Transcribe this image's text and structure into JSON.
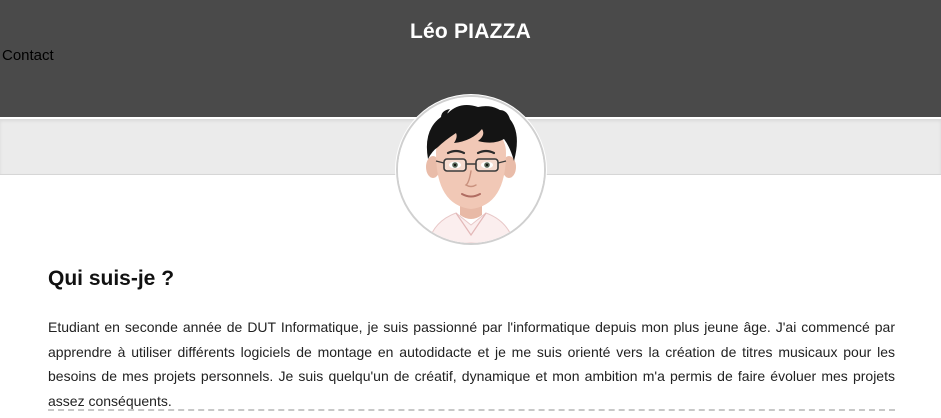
{
  "header": {
    "title": "Léo PIAZZA",
    "nav": {
      "contact_label": "Contact"
    },
    "background_color": "#4a4a4a"
  },
  "avatar": {
    "icon": "avatar-cartoon-portrait"
  },
  "about": {
    "heading": "Qui suis-je ?",
    "text": "Etudiant en seconde année de DUT Informatique, je suis passionné par l'informatique depuis mon plus jeune âge. J'ai commencé par apprendre à utiliser différents logiciels de montage en autodidacte et je me suis orienté vers la création de titres musicaux pour les besoins de mes projets personnels. Je suis quelqu'un de créatif, dynamique et mon ambition m'a permis de faire évoluer mes projets assez conséquents."
  }
}
